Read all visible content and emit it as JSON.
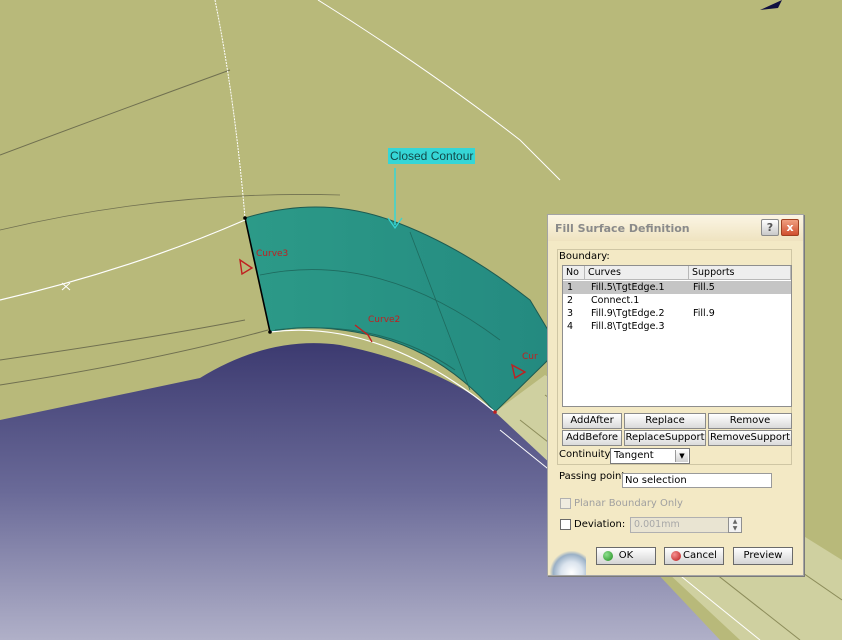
{
  "viewport": {
    "contour_label": "Closed Contour",
    "curve_labels": [
      "Curve3",
      "Curve2",
      "Cur"
    ]
  },
  "dialog": {
    "title": "Fill Surface Definition",
    "help_icon": "?",
    "close_icon": "x",
    "boundary_label": "Boundary:",
    "columns": [
      "No",
      "Curves",
      "Supports"
    ],
    "rows": [
      {
        "no": "1",
        "curve": "Fill.5\\TgtEdge.1",
        "support": "Fill.5",
        "selected": true
      },
      {
        "no": "2",
        "curve": "Connect.1",
        "support": "",
        "selected": false
      },
      {
        "no": "3",
        "curve": "Fill.9\\TgtEdge.2",
        "support": "Fill.9",
        "selected": false
      },
      {
        "no": "4",
        "curve": "Fill.8\\TgtEdge.3",
        "support": "",
        "selected": false
      }
    ],
    "buttons": {
      "add_after": "AddAfter",
      "replace": "Replace",
      "remove": "Remove",
      "add_before": "AddBefore",
      "replace_support": "ReplaceSupport",
      "remove_support": "RemoveSupport"
    },
    "continuity_label": "Continuity:",
    "continuity_value": "Tangent",
    "passing_point_label": "Passing point:",
    "passing_point_value": "No selection",
    "planar_boundary_label": "Planar Boundary Only",
    "deviation_label": "Deviation:",
    "deviation_value": "0.001mm",
    "ok_label": "OK",
    "cancel_label": "Cancel",
    "preview_label": "Preview"
  },
  "colors": {
    "surface": "#b8b97a",
    "fill_patch": "#2c9a88",
    "background_blue": "#4a4a82",
    "contour_highlight": "#35d6d6",
    "curve_label": "#c02020"
  }
}
